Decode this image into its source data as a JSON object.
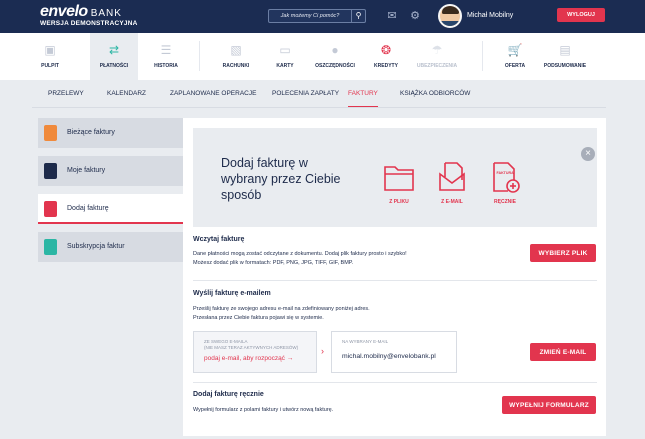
{
  "brand": {
    "name": "envelo",
    "bank": "BANK",
    "subtitle": "WERSJA DEMONSTRACYJNA"
  },
  "header": {
    "search_placeholder": "Jak możemy Ci pomóc?",
    "user_name": "Michał Mobilny",
    "logout_label": "WYLOGUJ"
  },
  "main_nav": [
    {
      "label": "PULPIT",
      "icon": "desktop-icon"
    },
    {
      "label": "PŁATNOŚCI",
      "icon": "transfer-icon",
      "active": true
    },
    {
      "label": "HISTORIA",
      "icon": "list-icon"
    },
    {
      "label": "RACHUNKI",
      "icon": "wallet-icon"
    },
    {
      "label": "KARTY",
      "icon": "card-icon"
    },
    {
      "label": "OSZCZĘDNOŚCI",
      "icon": "savings-icon"
    },
    {
      "label": "KREDYTY",
      "icon": "lifebuoy-icon"
    },
    {
      "label": "UBEZPIECZENIA",
      "icon": "umbrella-icon",
      "disabled": true
    },
    {
      "label": "OFERTA",
      "icon": "cart-icon"
    },
    {
      "label": "PODSUMOWANIE",
      "icon": "summary-icon"
    }
  ],
  "sub_nav": [
    "PRZELEWY",
    "KALENDARZ",
    "ZAPLANOWANE OPERACJE",
    "POLECENIA ZAPŁATY",
    "FAKTURY",
    "KSIĄŻKA ODBIORCÓW"
  ],
  "sub_nav_active": "FAKTURY",
  "side_menu": [
    {
      "label": "Bieżące faktury",
      "color": "#f08a3c"
    },
    {
      "label": "Moje faktury",
      "color": "#1d2a4a"
    },
    {
      "label": "Dodaj fakturę",
      "color": "#e2354e",
      "active": true
    },
    {
      "label": "Subskrypcja faktur",
      "color": "#2bb6a4"
    }
  ],
  "hero": {
    "title": "Dodaj fakturę w wybrany przez Ciebie sposób",
    "options": [
      {
        "label": "Z PLIKU",
        "icon": "folder-icon"
      },
      {
        "label": "Z E-MAIL",
        "icon": "email-document-icon"
      },
      {
        "label": "RĘCZNIE",
        "icon": "invoice-add-icon",
        "badge": "FAKTURA"
      }
    ]
  },
  "upload_section": {
    "title": "Wczytaj fakturę",
    "desc_line1": "Dane płatności mogą zostać odczytane z dokumentu. Dodaj plik faktury prosto i szybko!",
    "desc_line2": "Możesz dodać plik w formatach: PDF, PNG, JPG, TIFF, GIF, BMP.",
    "button": "WYBIERZ PLIK"
  },
  "email_section": {
    "title": "Wyślij fakturę e-mailem",
    "desc_line1": "Prześlij fakturę ze swojego adresu e-mail na zdefiniowany poniżej adres.",
    "desc_line2": "Przesłana przez Ciebie faktura pojawi się w systemie.",
    "from_label1": "ZE SWEGO E-MAILA",
    "from_label2": "(NIE MASZ TERAZ AKTYWNYCH ADRESÓW)",
    "from_link": "podaj e-mail, aby rozpocząć →",
    "to_label": "NA WYBRANY E-MAIL",
    "to_value": "michal.mobilny@envelobank.pl",
    "button": "ZMIEŃ E-MAIL"
  },
  "manual_section": {
    "title": "Dodaj fakturę ręcznie",
    "desc": "Wypełnij formularz z polami faktury i utwórz nową fakturę.",
    "button": "WYPEŁNIJ FORMULARZ"
  },
  "colors": {
    "accent": "#e2354e",
    "header_bg": "#1b2c52",
    "page_bg": "#e9ecf0"
  }
}
